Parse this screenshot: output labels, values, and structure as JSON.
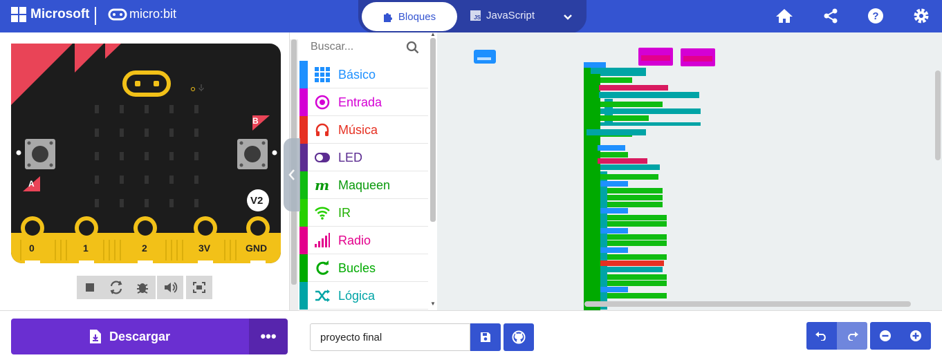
{
  "header": {
    "brand": "Microsoft",
    "product": "micro:bit",
    "tab_blocks": "Bloques",
    "tab_js": "JavaScript",
    "js_badge": "JS",
    "icons": [
      "home-icon",
      "share-icon",
      "help-icon",
      "settings-icon"
    ]
  },
  "simulator": {
    "button_a": "A",
    "button_b": "B",
    "version": "V2",
    "pins": [
      "0",
      "1",
      "2",
      "3V",
      "GND"
    ],
    "controls": [
      "stop-icon",
      "restart-icon",
      "debug-icon",
      "sound-icon",
      "fullscreen-icon"
    ]
  },
  "palette": {
    "search_placeholder": "Buscar...",
    "categories": [
      {
        "label": "Básico",
        "color": "#1e90ff"
      },
      {
        "label": "Entrada",
        "color": "#d400d4"
      },
      {
        "label": "Música",
        "color": "#e63022"
      },
      {
        "label": "LED",
        "color": "#5c2d91"
      },
      {
        "label": "Maqueen",
        "color": "#0fbc11"
      },
      {
        "label": "IR",
        "color": "#26d000"
      },
      {
        "label": "Radio",
        "color": "#e3008c"
      },
      {
        "label": "Bucles",
        "color": "#00aa00"
      },
      {
        "label": "Lógica",
        "color": "#00a4a6"
      }
    ]
  },
  "footer": {
    "download_label": "Descargar",
    "more_label": "•••",
    "project_name": "proyecto final"
  },
  "colors": {
    "header": "#3454d1",
    "download": "#6a2fd1",
    "workspace": "#ecf0f1"
  }
}
